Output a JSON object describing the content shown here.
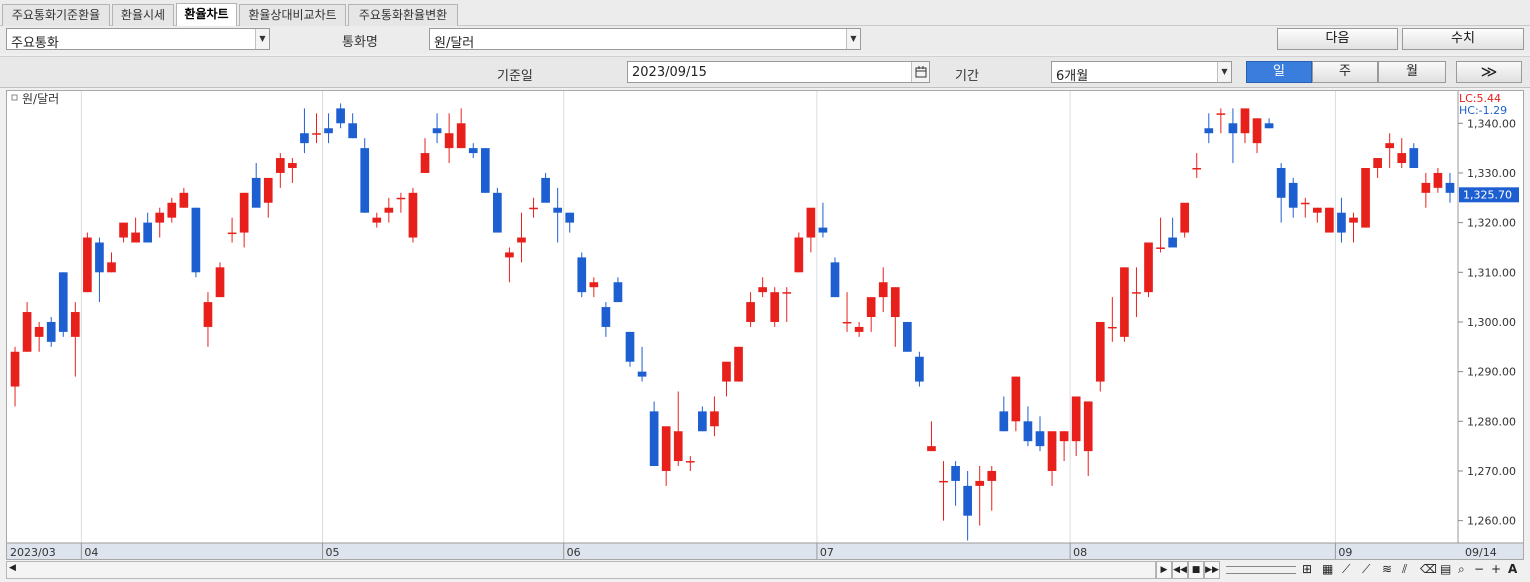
{
  "tabs": [
    "주요통화기준환율",
    "환율시세",
    "환율차트",
    "환율상대비교차트",
    "주요통화환율변환"
  ],
  "active_tab": 2,
  "toolbar": {
    "category_value": "주요통화",
    "currency_label": "통화명",
    "currency_value": "원/달러",
    "next_button": "다음",
    "values_button": "수치",
    "date_label": "기준일",
    "date_value": "2023/09/15",
    "period_label": "기간",
    "period_value": "6개월",
    "interval_day": "일",
    "interval_week": "주",
    "interval_month": "월",
    "active_interval": "일",
    "forward_button": "≫"
  },
  "chart_data": {
    "type": "candlestick",
    "legend": "원/달러",
    "lc_label": "LC:5.44",
    "hc_label": "HC:-1.29",
    "current_value_label": "1,325.70",
    "last_value": 1325.7,
    "ylim": [
      1255.5,
      1346.5
    ],
    "y_ticks": [
      "1,260.00",
      "1,270.00",
      "1,280.00",
      "1,290.00",
      "1,300.00",
      "1,310.00",
      "1,320.00",
      "1,330.00",
      "1,340.00"
    ],
    "x_start_label": "2023/03",
    "x_end_label": "09/14",
    "month_labels": [
      {
        "label": "04",
        "index": 6
      },
      {
        "label": "05",
        "index": 26
      },
      {
        "label": "06",
        "index": 46
      },
      {
        "label": "07",
        "index": 67
      },
      {
        "label": "08",
        "index": 88
      },
      {
        "label": "09",
        "index": 110
      }
    ],
    "up_color": "#e8201c",
    "down_color": "#1d5fd1",
    "candles": [
      [
        1287,
        1295,
        1283,
        1294
      ],
      [
        1294,
        1304,
        1294,
        1302
      ],
      [
        1297,
        1300,
        1294,
        1299
      ],
      [
        1300,
        1301,
        1295,
        1296
      ],
      [
        1310,
        1310,
        1297,
        1298
      ],
      [
        1297,
        1304,
        1289,
        1302
      ],
      [
        1306,
        1318,
        1306,
        1317
      ],
      [
        1316,
        1317,
        1304,
        1310
      ],
      [
        1310,
        1314,
        1310,
        1312
      ],
      [
        1317,
        1320,
        1316,
        1320
      ],
      [
        1316,
        1321,
        1316,
        1318
      ],
      [
        1320,
        1322,
        1316,
        1316
      ],
      [
        1320,
        1323,
        1317,
        1322
      ],
      [
        1321,
        1325,
        1320,
        1324
      ],
      [
        1323,
        1327,
        1323,
        1326
      ],
      [
        1323,
        1323,
        1309,
        1310
      ],
      [
        1299,
        1306,
        1295,
        1304
      ],
      [
        1305,
        1312,
        1305,
        1311
      ],
      [
        1318,
        1321,
        1316,
        1318
      ],
      [
        1318,
        1326,
        1315,
        1326
      ],
      [
        1329,
        1332,
        1324,
        1323
      ],
      [
        1324,
        1329,
        1321,
        1329
      ],
      [
        1330,
        1334,
        1327,
        1333
      ],
      [
        1331,
        1333,
        1328,
        1332
      ],
      [
        1338,
        1343,
        1334,
        1336
      ],
      [
        1338,
        1342,
        1336,
        1338
      ],
      [
        1339,
        1342,
        1336,
        1338
      ],
      [
        1343,
        1344,
        1339,
        1340
      ],
      [
        1340,
        1342,
        1337,
        1337
      ],
      [
        1335,
        1337,
        1322,
        1322
      ],
      [
        1320,
        1322,
        1319,
        1321
      ],
      [
        1322,
        1325,
        1320,
        1323
      ],
      [
        1325,
        1326,
        1322,
        1325
      ],
      [
        1317,
        1327,
        1316,
        1326
      ],
      [
        1330,
        1337,
        1330,
        1334
      ],
      [
        1339,
        1342,
        1336,
        1338
      ],
      [
        1335,
        1342,
        1332,
        1338
      ],
      [
        1335,
        1343,
        1335,
        1340
      ],
      [
        1335,
        1336,
        1333,
        1334
      ],
      [
        1335,
        1335,
        1326,
        1326
      ],
      [
        1326,
        1327,
        1318,
        1318
      ],
      [
        1313,
        1315,
        1308,
        1314
      ],
      [
        1316,
        1322,
        1312,
        1317
      ],
      [
        1323,
        1325,
        1321,
        1323
      ],
      [
        1329,
        1330,
        1326,
        1324
      ],
      [
        1323,
        1327,
        1316,
        1322
      ],
      [
        1322,
        1322,
        1318,
        1320
      ],
      [
        1313,
        1314,
        1305,
        1306
      ],
      [
        1307,
        1309,
        1305,
        1308
      ],
      [
        1303,
        1304,
        1297,
        1299
      ],
      [
        1308,
        1309,
        1304,
        1304
      ],
      [
        1298,
        1298,
        1291,
        1292
      ],
      [
        1290,
        1295,
        1288,
        1289
      ],
      [
        1282,
        1284,
        1271,
        1271
      ],
      [
        1270,
        1277,
        1267,
        1279
      ],
      [
        1272,
        1286,
        1271,
        1278
      ],
      [
        1272,
        1273,
        1270,
        1272
      ],
      [
        1282,
        1283,
        1278,
        1278
      ],
      [
        1279,
        1285,
        1277,
        1282
      ],
      [
        1288,
        1290,
        1285,
        1292
      ],
      [
        1288,
        1295,
        1288,
        1295
      ],
      [
        1300,
        1306,
        1299,
        1304
      ],
      [
        1306,
        1309,
        1305,
        1307
      ],
      [
        1300,
        1307,
        1299,
        1306
      ],
      [
        1306,
        1307,
        1300,
        1306
      ],
      [
        1310,
        1318,
        1310,
        1317
      ],
      [
        1317,
        1322,
        1314,
        1323
      ],
      [
        1319,
        1324,
        1317,
        1318
      ],
      [
        1312,
        1313,
        1305,
        1305
      ],
      [
        1300,
        1306,
        1298,
        1300
      ],
      [
        1298,
        1300,
        1297,
        1299
      ],
      [
        1301,
        1304,
        1298,
        1305
      ],
      [
        1305,
        1311,
        1302,
        1308
      ],
      [
        1301,
        1307,
        1295,
        1307
      ],
      [
        1300,
        1300,
        1294,
        1294
      ],
      [
        1293,
        1294,
        1287,
        1288
      ],
      [
        1274,
        1280,
        1274,
        1275
      ],
      [
        1268,
        1272,
        1260,
        1268
      ],
      [
        1271,
        1272,
        1263,
        1268
      ],
      [
        1267,
        1270,
        1256,
        1261
      ],
      [
        1267,
        1271,
        1259,
        1268
      ],
      [
        1268,
        1271,
        1262,
        1270
      ],
      [
        1282,
        1285,
        1278,
        1278
      ],
      [
        1280,
        1289,
        1278,
        1289
      ],
      [
        1280,
        1283,
        1275,
        1276
      ],
      [
        1278,
        1281,
        1274,
        1275
      ],
      [
        1270,
        1277,
        1267,
        1278
      ],
      [
        1276,
        1278,
        1272,
        1278
      ],
      [
        1276,
        1285,
        1273,
        1285
      ],
      [
        1274,
        1276,
        1269,
        1284
      ],
      [
        1288,
        1300,
        1286,
        1300
      ],
      [
        1299,
        1305,
        1296,
        1299
      ],
      [
        1297,
        1311,
        1296,
        1311
      ],
      [
        1306,
        1311,
        1301,
        1306
      ],
      [
        1306,
        1316,
        1305,
        1316
      ],
      [
        1315,
        1321,
        1314,
        1315
      ],
      [
        1317,
        1321,
        1316,
        1315
      ],
      [
        1318,
        1323,
        1317,
        1324
      ],
      [
        1331,
        1334,
        1329,
        1331
      ],
      [
        1339,
        1342,
        1336,
        1338
      ],
      [
        1342,
        1343,
        1338,
        1342
      ],
      [
        1340,
        1343,
        1332,
        1338
      ],
      [
        1338,
        1342,
        1336,
        1343
      ],
      [
        1336,
        1341,
        1334,
        1341
      ],
      [
        1340,
        1341,
        1339,
        1339
      ],
      [
        1331,
        1332,
        1320,
        1325
      ],
      [
        1328,
        1329,
        1321,
        1323
      ],
      [
        1324,
        1325,
        1321,
        1324
      ],
      [
        1322,
        1323,
        1320,
        1323
      ],
      [
        1318,
        1323,
        1318,
        1323
      ],
      [
        1322,
        1325,
        1316,
        1318
      ],
      [
        1320,
        1322,
        1316,
        1321
      ],
      [
        1319,
        1331,
        1319,
        1331
      ],
      [
        1331,
        1333,
        1329,
        1333
      ],
      [
        1335,
        1338,
        1331,
        1336
      ],
      [
        1332,
        1337,
        1331,
        1334
      ],
      [
        1335,
        1336,
        1332,
        1331
      ],
      [
        1326,
        1330,
        1323,
        1328
      ],
      [
        1327,
        1331,
        1326,
        1330
      ],
      [
        1328,
        1330,
        1324,
        1326
      ]
    ]
  }
}
